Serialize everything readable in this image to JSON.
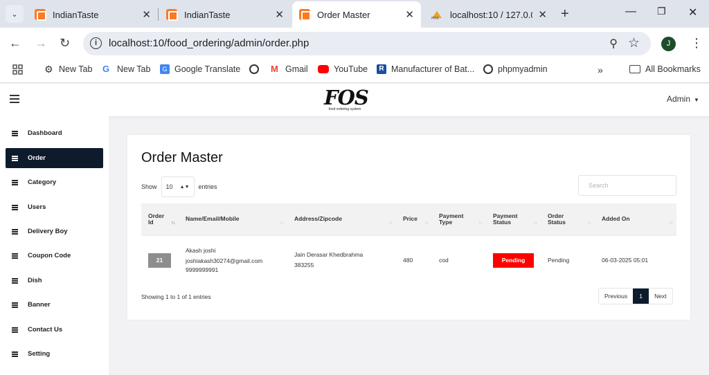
{
  "browser": {
    "tabs": [
      {
        "title": "IndianTaste"
      },
      {
        "title": "IndianTaste"
      },
      {
        "title": "Order Master"
      },
      {
        "title": "localhost:10 / 127.0.0.1"
      }
    ],
    "url": "localhost:10/food_ordering/admin/order.php",
    "profile_initial": "J",
    "bookmarks": [
      "New Tab",
      "New Tab",
      "Google Translate",
      "Gmail",
      "YouTube",
      "Manufacturer of Bat...",
      "phpmyadmin"
    ],
    "all_bookmarks": "All Bookmarks"
  },
  "header": {
    "logo_mark": "FOS",
    "logo_sub": "food ordering system",
    "admin_label": "Admin"
  },
  "sidebar": {
    "items": [
      "Dashboard",
      "Order",
      "Category",
      "Users",
      "Delivery Boy",
      "Coupon Code",
      "Dish",
      "Banner",
      "Contact Us",
      "Setting"
    ],
    "active": "Order"
  },
  "page": {
    "title": "Order Master",
    "show_label": "Show",
    "entries_value": "10",
    "entries_label": "entries",
    "search_placeholder": "Search",
    "columns": [
      "Order Id",
      "Name/Email/Mobile",
      "Address/Zipcode",
      "Price",
      "Payment Type",
      "Payment Status",
      "Order Status",
      "Added On"
    ],
    "rows": [
      {
        "order_id": "21",
        "name": "Akash joshi",
        "email": "joshiakash30274@gmail.com",
        "mobile": "9999999991",
        "address": "Jain Derasar Khedbrahma",
        "zipcode": "383255",
        "price": "480",
        "payment_type": "cod",
        "payment_status": "Pending",
        "order_status": "Pending",
        "added_on": "06-03-2025 05:01"
      }
    ],
    "info": "Showing 1 to 1 of 1 entries",
    "pager": {
      "previous": "Previous",
      "current": "1",
      "next": "Next"
    }
  },
  "colors": {
    "active_nav": "#0e1b2c",
    "pending_badge": "#ff0000",
    "id_badge": "#8e8e8e",
    "xampp_orange": "#fb7a24"
  }
}
